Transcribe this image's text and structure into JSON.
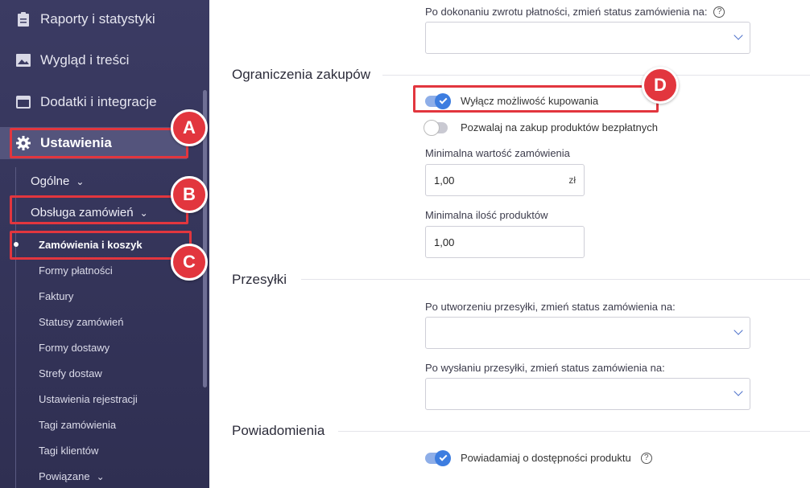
{
  "sidebar": {
    "top_items": [
      {
        "label": "Raporty i statystyki",
        "icon": "clipboard-icon"
      },
      {
        "label": "Wygląd i treści",
        "icon": "image-icon"
      },
      {
        "label": "Dodatki i integracje",
        "icon": "window-icon"
      },
      {
        "label": "Ustawienia",
        "icon": "gear-icon"
      }
    ],
    "sub_items": [
      {
        "label": "Ogólne"
      },
      {
        "label": "Obsługa zamówień"
      }
    ],
    "leaf_items": [
      "Zamówienia i koszyk",
      "Formy płatności",
      "Faktury",
      "Statusy zamówień",
      "Formy dostawy",
      "Strefy dostaw",
      "Ustawienia rejestracji",
      "Tagi zamówienia",
      "Tagi klientów",
      "Powiązane"
    ],
    "chevron": "⌄"
  },
  "annotations": {
    "a": "A",
    "b": "B",
    "c": "C",
    "d": "D",
    "color": "#e2363e"
  },
  "main": {
    "refund_label": "Po dokonaniu zwrotu płatności, zmień status zamówienia na:",
    "help_glyph": "?",
    "section_limits": "Ograniczenia zakupów",
    "toggle_disable_buying": "Wyłącz możliwość kupowania",
    "toggle_free_products": "Pozwalaj na zakup produktów bezpłatnych",
    "min_value_label": "Minimalna wartość zamówienia",
    "min_value": "1,00",
    "min_value_unit": "zł",
    "min_qty_label": "Minimalna ilość produktów",
    "min_qty": "1,00",
    "section_shipping": "Przesyłki",
    "shipment_created_label": "Po utworzeniu przesyłki, zmień status zamówienia na:",
    "shipment_sent_label": "Po wysłaniu przesyłki, zmień status zamówienia na:",
    "section_notifications": "Powiadomienia",
    "toggle_notify_availability": "Powiadamiaj o dostępności produktu"
  }
}
